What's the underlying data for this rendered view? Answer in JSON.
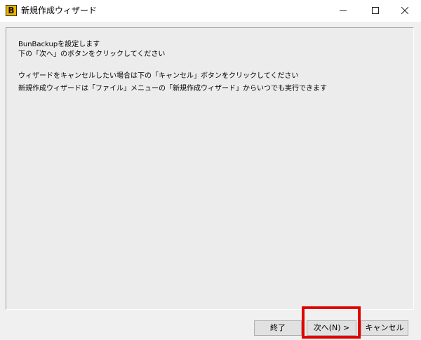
{
  "window": {
    "title": "新規作成ウィザード",
    "icon": "bunbackup-app-icon",
    "icon_letter": "B"
  },
  "caption_buttons": {
    "minimize_icon": "minimize-icon",
    "maximize_icon": "maximize-icon",
    "close_icon": "close-icon"
  },
  "message": {
    "line1": "BunBackupを設定します",
    "line2": "下の「次へ」のボタンをクリックしてください",
    "line3": "ウィザードをキャンセルしたい場合は下の「キャンセル」ボタンをクリックしてください",
    "line4": "新規作成ウィザードは「ファイル」メニューの「新規作成ウィザード」からいつでも実行できます"
  },
  "buttons": {
    "finish": "終了",
    "next": "次へ(N) >",
    "cancel": "キャンセル"
  },
  "colors": {
    "highlight": "#e10000",
    "dialog_bg": "#f0f0f0"
  }
}
